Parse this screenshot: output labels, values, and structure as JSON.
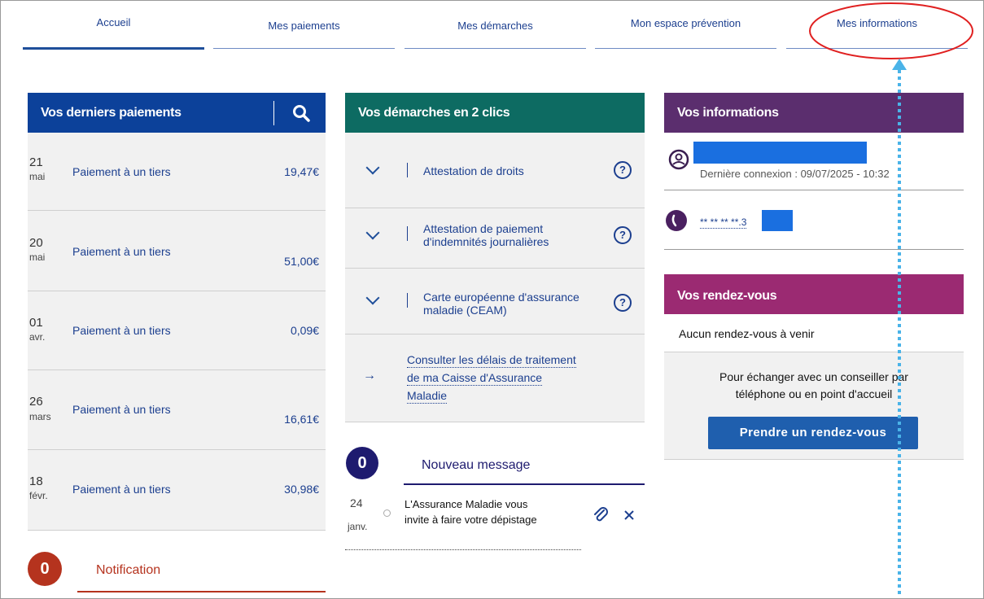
{
  "nav": {
    "tabs": [
      {
        "label": "Accueil"
      },
      {
        "label": "Mes paiements"
      },
      {
        "label": "Mes démarches"
      },
      {
        "label": "Mon espace prévention"
      },
      {
        "label": "Mes informations"
      }
    ]
  },
  "payments": {
    "title": "Vos derniers paiements",
    "rows": [
      {
        "day": "21",
        "month": "mai",
        "label": "Paiement à un tiers",
        "amount": "19,47€"
      },
      {
        "day": "20",
        "month": "mai",
        "label": "Paiement à un tiers",
        "amount": "51,00€"
      },
      {
        "day": "01",
        "month": "avr.",
        "label": "Paiement à un tiers",
        "amount": "0,09€"
      },
      {
        "day": "26",
        "month": "mars",
        "label": "Paiement à un tiers",
        "amount": "16,61€"
      },
      {
        "day": "18",
        "month": "févr.",
        "label": "Paiement à un tiers",
        "amount": "30,98€"
      }
    ]
  },
  "notification": {
    "count": "0",
    "title": "Notification"
  },
  "demarches": {
    "title": "Vos démarches en 2 clics",
    "items": [
      {
        "lines": [
          "Attestation de droits"
        ]
      },
      {
        "lines": [
          "Attestation de paiement",
          "d'indemnités journalières"
        ]
      },
      {
        "lines": [
          "Carte européenne d'assurance",
          "maladie (CEAM)"
        ]
      }
    ],
    "help_glyph": "?",
    "link_lines": [
      "Consulter les délais de traitement",
      "de ma Caisse d'Assurance",
      "Maladie"
    ],
    "arrow": "→"
  },
  "messages": {
    "count": "0",
    "title": "Nouveau message",
    "item": {
      "day": "24",
      "month": "janv.",
      "lines": [
        "L'Assurance Maladie vous",
        "invite à faire votre dépistage"
      ]
    }
  },
  "infos": {
    "title": "Vos informations",
    "last_login": "Dernière connexion : 09/07/2025 - 10:32",
    "phone_masked": "** ** ** **.3"
  },
  "rdv": {
    "title": "Vos rendez-vous",
    "none": "Aucun rendez-vous à venir",
    "desc_lines": [
      "Pour échanger avec un conseiller par",
      "téléphone ou en point d'accueil"
    ],
    "button": "Prendre un rendez-vous"
  },
  "colors": {
    "payments_header": "#0c419a",
    "demarches_header": "#0d6b62",
    "infos_header": "#5b2e6e",
    "rdv_header": "#9b2a72",
    "notification": "#b5331e",
    "message_circle": "#1e1b6f",
    "annotation_red": "#e02020",
    "annotation_dotted": "#4ab3e8"
  }
}
